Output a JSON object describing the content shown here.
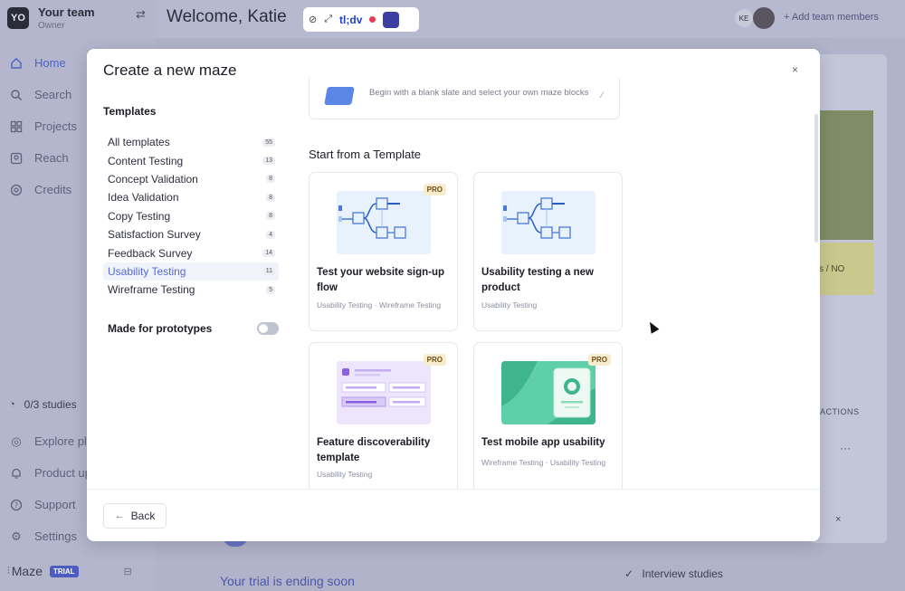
{
  "team": {
    "avatar": "YO",
    "name": "Your team",
    "role": "Owner"
  },
  "nav": [
    {
      "label": "Home",
      "icon": "home-icon"
    },
    {
      "label": "Search",
      "icon": "search-icon"
    },
    {
      "label": "Projects",
      "icon": "grid-icon"
    },
    {
      "label": "Reach",
      "icon": "reach-icon"
    },
    {
      "label": "Credits",
      "icon": "credits-icon"
    }
  ],
  "studies": "0/3 studies",
  "nav2": [
    {
      "label": "Explore pl",
      "icon": "compass-icon"
    },
    {
      "label": "Product up",
      "icon": "bell-icon"
    },
    {
      "label": "Support",
      "icon": "help-icon"
    },
    {
      "label": "Settings",
      "icon": "gear-icon"
    }
  ],
  "brand": {
    "name": "Maze",
    "badge": "TRIAL"
  },
  "header": {
    "welcome": "Welcome, Katie",
    "tldv": "tl;dv",
    "user_initials": "KE",
    "add_members": "Add team members"
  },
  "background": {
    "yesno": "s / NO",
    "actions": "ACTIONS",
    "dots": "···",
    "close": "×",
    "trial": "Your trial is ending soon",
    "interview": "Interview studies"
  },
  "modal": {
    "title": "Create a new maze",
    "close": "×",
    "left_heading": "Templates",
    "categories": [
      {
        "label": "All templates",
        "count": "55"
      },
      {
        "label": "Content Testing",
        "count": "13"
      },
      {
        "label": "Concept Validation",
        "count": "8"
      },
      {
        "label": "Idea Validation",
        "count": "8"
      },
      {
        "label": "Copy Testing",
        "count": "8"
      },
      {
        "label": "Satisfaction Survey",
        "count": "4"
      },
      {
        "label": "Feedback Survey",
        "count": "14"
      },
      {
        "label": "Usability Testing",
        "count": "11"
      },
      {
        "label": "Wireframe Testing",
        "count": "5"
      }
    ],
    "selected_category": "Usability Testing",
    "prototypes_label": "Made for prototypes",
    "prototypes_toggle": "off",
    "blank_text": "Begin with a blank slate and select your own maze blocks",
    "section_title": "Start from a Template",
    "templates": [
      {
        "title": "Test your website sign-up flow",
        "tags": "Usability Testing · Wireframe Testing",
        "pro": "PRO"
      },
      {
        "title": "Usability testing a new product",
        "tags": "Usability Testing",
        "pro": ""
      },
      {
        "title": "Feature discoverability template",
        "tags": "Usability Testing",
        "pro": "PRO"
      },
      {
        "title": "Test mobile app usability",
        "tags": "Wireframe Testing · Usability Testing",
        "pro": "PRO"
      }
    ],
    "back_label": "Back"
  },
  "colors": {
    "accent": "#5368d8",
    "overlay": "#b6b9d0",
    "pro_bg": "#f7ecd0"
  }
}
